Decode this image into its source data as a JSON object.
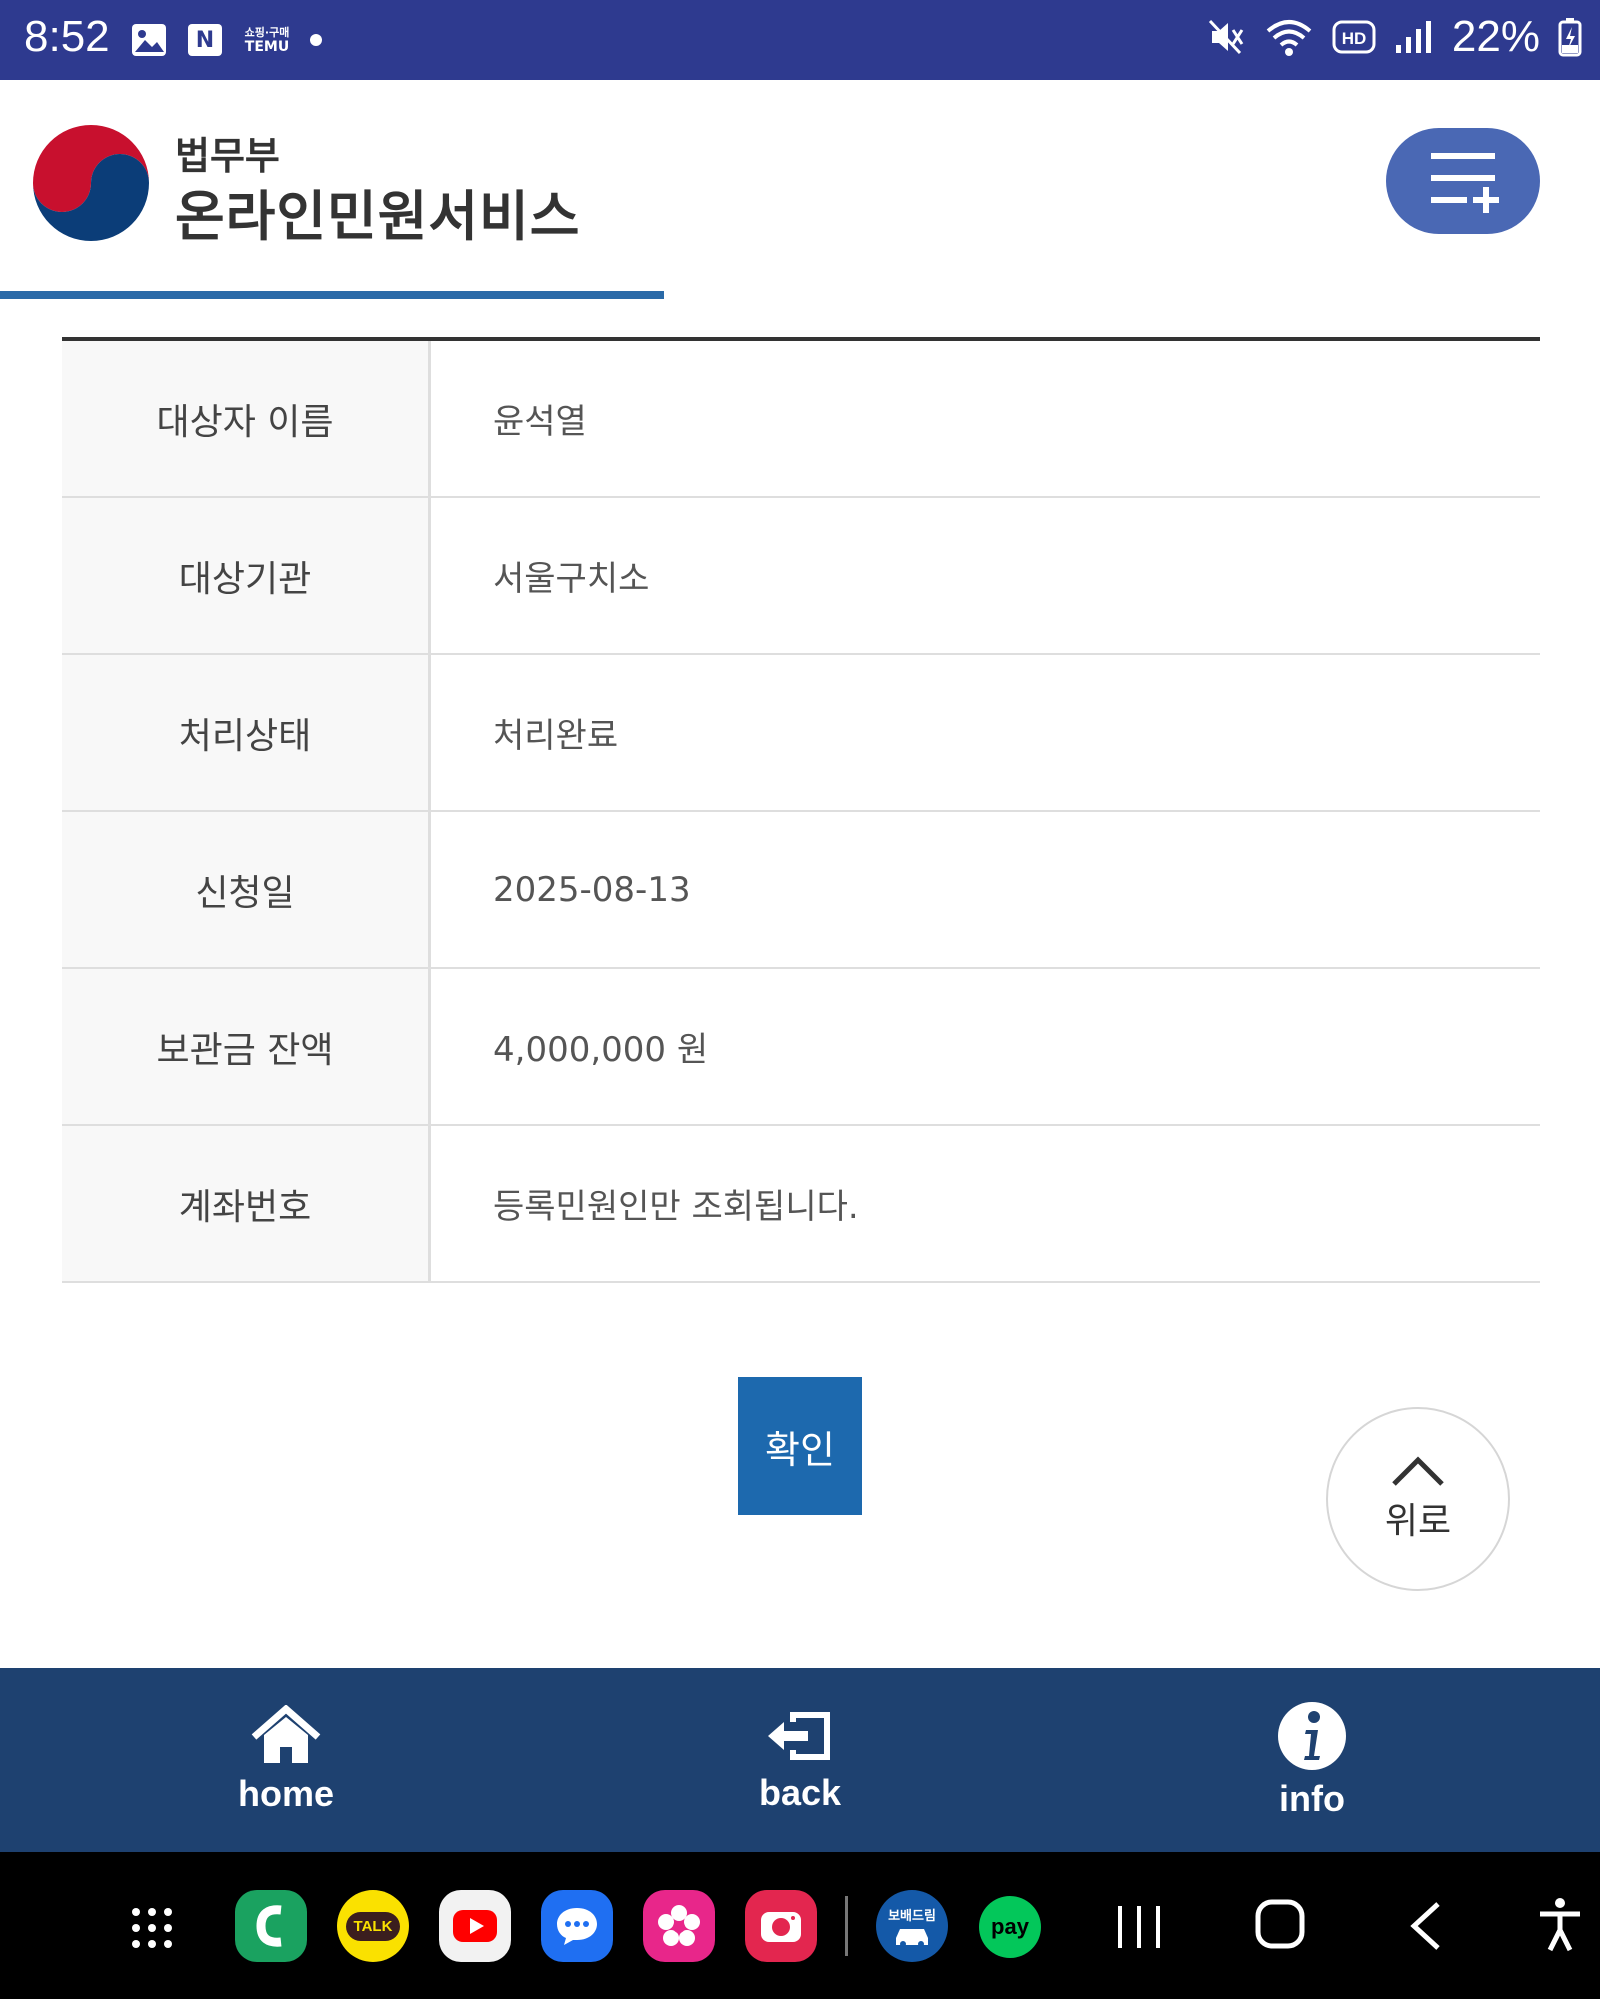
{
  "status_bar": {
    "time": "8:52",
    "notif_icons": [
      "gallery-icon",
      "naver-icon",
      "temu-icon"
    ],
    "naver_letter": "N",
    "temu_line1": "쇼핑·구매",
    "temu_line2": "TEMU",
    "battery": "22%"
  },
  "header": {
    "brand_small": "법무부",
    "brand_big": "온라인민원서비스"
  },
  "table": {
    "rows": [
      {
        "label": "대상자 이름",
        "value": "윤석열"
      },
      {
        "label": "대상기관",
        "value": "서울구치소"
      },
      {
        "label": "처리상태",
        "value": "처리완료"
      },
      {
        "label": "신청일",
        "value": "2025-08-13"
      },
      {
        "label": "보관금 잔액",
        "value": "4,000,000 원"
      },
      {
        "label": "계좌번호",
        "value": "등록민원인만 조회됩니다."
      }
    ]
  },
  "buttons": {
    "confirm": "확인",
    "to_top": "위로"
  },
  "bottom_nav": {
    "home": "home",
    "back": "back",
    "info": "info"
  },
  "dock": {
    "talk": "TALK",
    "pay": "pay",
    "bm": "보배드림"
  },
  "colors": {
    "status_bar": "#2e3a8f",
    "accent": "#1d69ae",
    "menu": "#4a68b4",
    "bottom_nav": "#1e4170"
  }
}
